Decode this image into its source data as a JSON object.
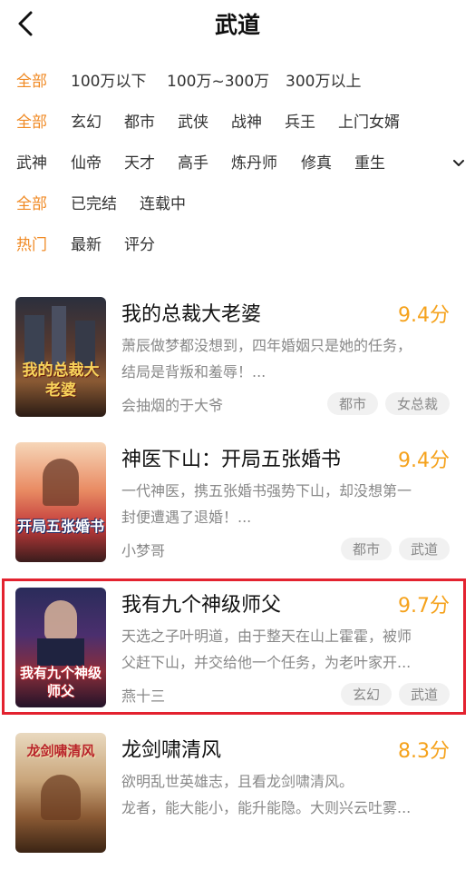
{
  "header": {
    "title": "武道"
  },
  "filters": {
    "rows": [
      {
        "items": [
          "全部",
          "100万以下",
          "100万~300万",
          "300万以上"
        ],
        "active": 0
      },
      {
        "items": [
          "全部",
          "玄幻",
          "都市",
          "武侠",
          "战神",
          "兵王",
          "上门女婿"
        ],
        "active": 0
      },
      {
        "items": [
          "武神",
          "仙帝",
          "天才",
          "高手",
          "炼丹师",
          "修真",
          "重生"
        ],
        "active": -1
      },
      {
        "items": [
          "全部",
          "已完结",
          "连载中"
        ],
        "active": 0
      },
      {
        "items": [
          "热门",
          "最新",
          "评分"
        ],
        "active": 0
      }
    ]
  },
  "books": [
    {
      "title": "我的总裁大老婆",
      "score": "9.4分",
      "desc1": "萧辰做梦都没想到，四年婚姻只是她的任务，",
      "desc2": "结局是背叛和羞辱！...",
      "author": "会抽烟的于大爷",
      "tags": [
        "都市",
        "女总裁"
      ],
      "cover_text": "我的总裁大老婆"
    },
    {
      "title": "神医下山：开局五张婚书",
      "score": "9.4分",
      "desc1": "一代神医，携五张婚书强势下山，却没想第一",
      "desc2": "封便遭遇了退婚！...",
      "author": "小梦哥",
      "tags": [
        "都市",
        "武道"
      ],
      "cover_text": "开局五张婚书"
    },
    {
      "title": "我有九个神级师父",
      "score": "9.7分",
      "desc1": "天选之子叶明道，由于整天在山上霍霍，被师",
      "desc2": "父赶下山，并交给他一个任务，为老叶家开...",
      "author": "燕十三",
      "tags": [
        "玄幻",
        "武道"
      ],
      "cover_text": "我有九个神级师父"
    },
    {
      "title": "龙剑啸清风",
      "score": "8.3分",
      "desc1": "欲明乱世英雄志，且看龙剑啸清风。",
      "desc2": "龙者，能大能小，能升能隐。大则兴云吐雾...",
      "author": "",
      "tags": [],
      "cover_text": "龙剑啸清风"
    }
  ],
  "colors": {
    "accent": "#f08a24",
    "score": "#f5a21c",
    "selection": "#e3222f"
  }
}
